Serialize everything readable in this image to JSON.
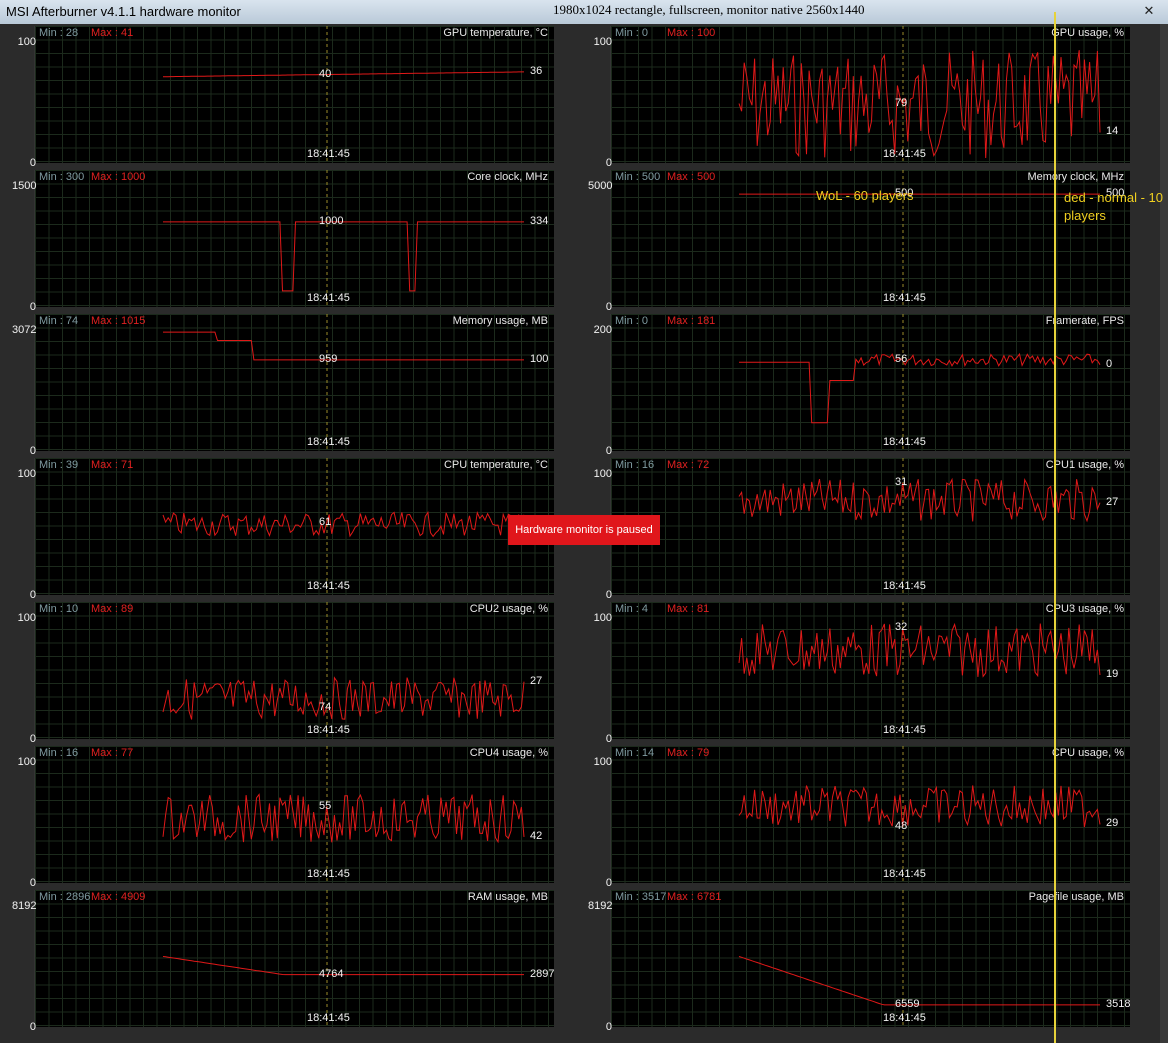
{
  "window": {
    "title": "MSI Afterburner v4.1.1 hardware monitor",
    "overlay_caption": "1980x1024 rectangle, fullscreen, monitor native 2560x1440",
    "close_label": "✕"
  },
  "status": {
    "paused": "Hardware monitor is paused"
  },
  "annotations": [
    {
      "text": "WoL - 60 players"
    },
    {
      "text": "ded - normal - 10"
    },
    {
      "text": "players"
    }
  ],
  "colors": {
    "graph": "#e01818",
    "grid": "#1c2a1c",
    "min_text": "#7f9aa0",
    "max_text": "#e02020",
    "marker": "#e6d23a",
    "paused_bg": "#e0161b"
  },
  "panels": [
    {
      "title": "GPU temperature, °C",
      "min": "Min : 28",
      "max": "Max : 41",
      "ymax": "100",
      "ymin": "0",
      "current": "36",
      "cursor": "40",
      "time": "18:41:45"
    },
    {
      "title": "GPU usage, %",
      "min": "Min : 0",
      "max": "Max : 100",
      "ymax": "100",
      "ymin": "0",
      "current": "14",
      "cursor": "79",
      "time": "18:41:45"
    },
    {
      "title": "Core clock, MHz",
      "min": "Min : 300",
      "max": "Max : 1000",
      "ymax": "1500",
      "ymin": "0",
      "current": "334",
      "cursor": "1000",
      "time": "18:41:45"
    },
    {
      "title": "Memory clock, MHz",
      "min": "Min : 500",
      "max": "Max : 500",
      "ymax": "5000",
      "ymin": "0",
      "current": "500",
      "cursor": "500",
      "time": "18:41:45"
    },
    {
      "title": "Memory usage, MB",
      "min": "Min : 74",
      "max": "Max : 1015",
      "ymax": "3072",
      "ymin": "0",
      "current": "100",
      "cursor": "959",
      "time": "18:41:45"
    },
    {
      "title": "Framerate, FPS",
      "min": "Min : 0",
      "max": "Max : 181",
      "ymax": "200",
      "ymin": "0",
      "current": "0",
      "cursor": "56",
      "time": "18:41:45"
    },
    {
      "title": "CPU temperature, °C",
      "min": "Min : 39",
      "max": "Max : 71",
      "ymax": "100",
      "ymin": "0",
      "current": "",
      "cursor": "61",
      "time": "18:41:45"
    },
    {
      "title": "CPU1 usage, %",
      "min": "Min : 16",
      "max": "Max : 72",
      "ymax": "100",
      "ymin": "0",
      "current": "27",
      "cursor": "31",
      "time": "18:41:45"
    },
    {
      "title": "CPU2 usage, %",
      "min": "Min : 10",
      "max": "Max : 89",
      "ymax": "100",
      "ymin": "0",
      "current": "27",
      "cursor": "74",
      "time": "18:41:45"
    },
    {
      "title": "CPU3 usage, %",
      "min": "Min : 4",
      "max": "Max : 81",
      "ymax": "100",
      "ymin": "0",
      "current": "19",
      "cursor": "32",
      "time": "18:41:45"
    },
    {
      "title": "CPU4 usage, %",
      "min": "Min : 16",
      "max": "Max : 77",
      "ymax": "100",
      "ymin": "0",
      "current": "42",
      "cursor": "55",
      "time": "18:41:45"
    },
    {
      "title": "CPU usage, %",
      "min": "Min : 14",
      "max": "Max : 79",
      "ymax": "100",
      "ymin": "0",
      "current": "29",
      "cursor": "48",
      "time": "18:41:45"
    },
    {
      "title": "RAM usage, MB",
      "min": "Min : 2896",
      "max": "Max : 4909",
      "ymax": "8192",
      "ymin": "0",
      "current": "2897",
      "cursor": "4764",
      "time": "18:41:45"
    },
    {
      "title": "Pagefile usage, MB",
      "min": "Min : 3517",
      "max": "Max : 6781",
      "ymax": "8192",
      "ymin": "0",
      "current": "3518",
      "cursor": "6559",
      "time": "18:41:45"
    }
  ]
}
